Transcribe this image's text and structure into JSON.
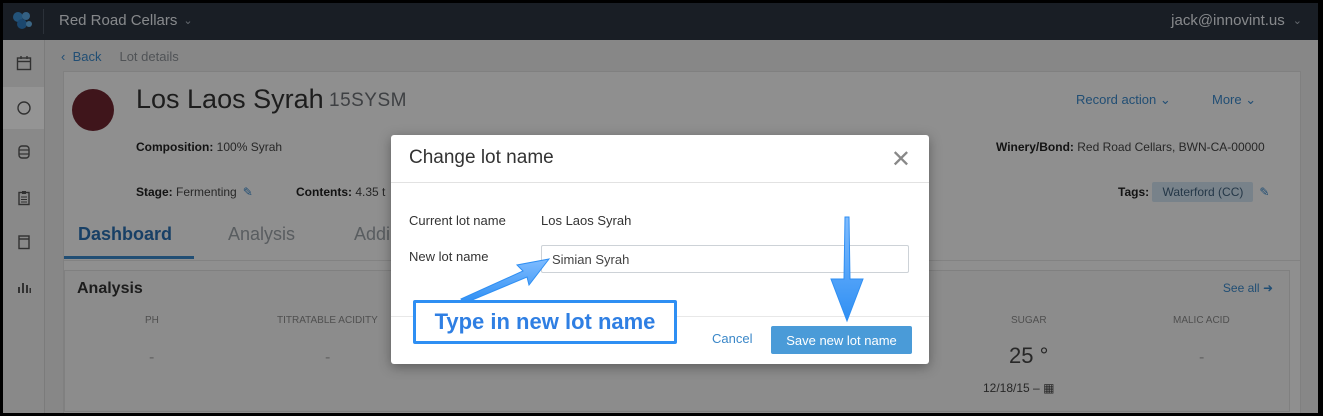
{
  "topbar": {
    "org": "Red Road Cellars",
    "user": "jack@innovint.us"
  },
  "breadcrumb": {
    "back": "Back",
    "current": "Lot details"
  },
  "lot": {
    "name": "Los Laos Syrah",
    "code": "15SYSM",
    "record_action": "Record action",
    "more": "More",
    "composition_label": "Composition:",
    "composition": "100% Syrah",
    "stage_label": "Stage:",
    "stage": "Fermenting",
    "contents_label": "Contents:",
    "contents": "4.35 t",
    "winery_label": "Winery/Bond:",
    "winery": "Red Road Cellars, BWN-CA-00000",
    "tags_label": "Tags:",
    "tag": "Waterford (CC)"
  },
  "tabs": [
    "Dashboard",
    "Analysis",
    "Addi"
  ],
  "analysis": {
    "title": "Analysis",
    "see_all": "See all",
    "columns": [
      "PH",
      "TITRATABLE ACIDITY",
      "SUGAR",
      "MALIC ACID"
    ],
    "values": [
      "-",
      "-",
      "25 °",
      "-"
    ],
    "sugar_date": "12/18/15 –"
  },
  "modal": {
    "title": "Change lot name",
    "current_label": "Current lot name",
    "current_value": "Los Laos Syrah",
    "new_label": "New lot name",
    "new_value": "Simian Syrah",
    "cancel": "Cancel",
    "save": "Save new lot name"
  },
  "annotation": {
    "callout": "Type in new lot name",
    "color": "#2f8ff3"
  },
  "colors": {
    "topbar": "#2b3440",
    "accent": "#3a87c8",
    "lot_dot": "#6d2530",
    "primary_button": "#4a9bd8"
  },
  "icons": [
    "logo-icon",
    "chevron-down-icon",
    "calendar-icon",
    "circle-icon",
    "barrel-icon",
    "clipboard-icon",
    "tank-icon",
    "bar-chart-icon",
    "pencil-icon",
    "arrow-right-icon",
    "close-icon",
    "calendar-small-icon"
  ]
}
